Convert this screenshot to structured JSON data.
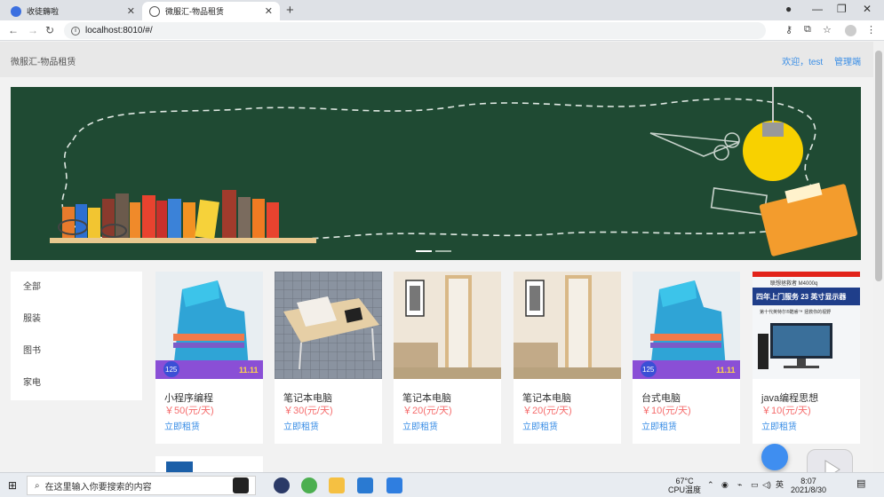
{
  "browser": {
    "tabs": [
      {
        "title": "收徒薅啦",
        "active": false
      },
      {
        "title": "微服汇-物品租赁",
        "active": true
      }
    ],
    "url": "localhost:8010/#/"
  },
  "header": {
    "brand": "微服汇-物品租赁",
    "welcome": "欢迎，test",
    "admin": "管理端"
  },
  "categories": [
    "全部",
    "服装",
    "图书",
    "家电"
  ],
  "products": [
    {
      "name": "小程序编程",
      "price": "￥50(元/天)",
      "action": "立即租赁",
      "image": "chairs"
    },
    {
      "name": "笔记本电脑",
      "price": "￥30(元/天)",
      "action": "立即租赁",
      "image": "laptop-table"
    },
    {
      "name": "笔记本电脑",
      "price": "￥20(元/天)",
      "action": "立即租赁",
      "image": "mirror"
    },
    {
      "name": "笔记本电脑",
      "price": "￥20(元/天)",
      "action": "立即租赁",
      "image": "mirror"
    },
    {
      "name": "台式电脑",
      "price": "￥10(元/天)",
      "action": "立即租赁",
      "image": "chairs"
    },
    {
      "name": "java编程思想",
      "price": "￥10(元/天)",
      "action": "立即租赁",
      "image": "monitor"
    }
  ],
  "chairs_overlay": {
    "badge": "125",
    "mark": "11.11"
  },
  "monitor_overlay": {
    "line1": "联想拯救者 M4000q",
    "line2": "四年上门服务 23 英寸显示器",
    "line3": "第十代英特尔®酷睿™ 拯救你的视野"
  },
  "taskbar": {
    "search_placeholder": "在这里输入你要搜索的内容",
    "temp": "67°C",
    "temp_label": "CPU温度",
    "time": "8:07",
    "date": "2021/8/30",
    "ime": "英"
  }
}
